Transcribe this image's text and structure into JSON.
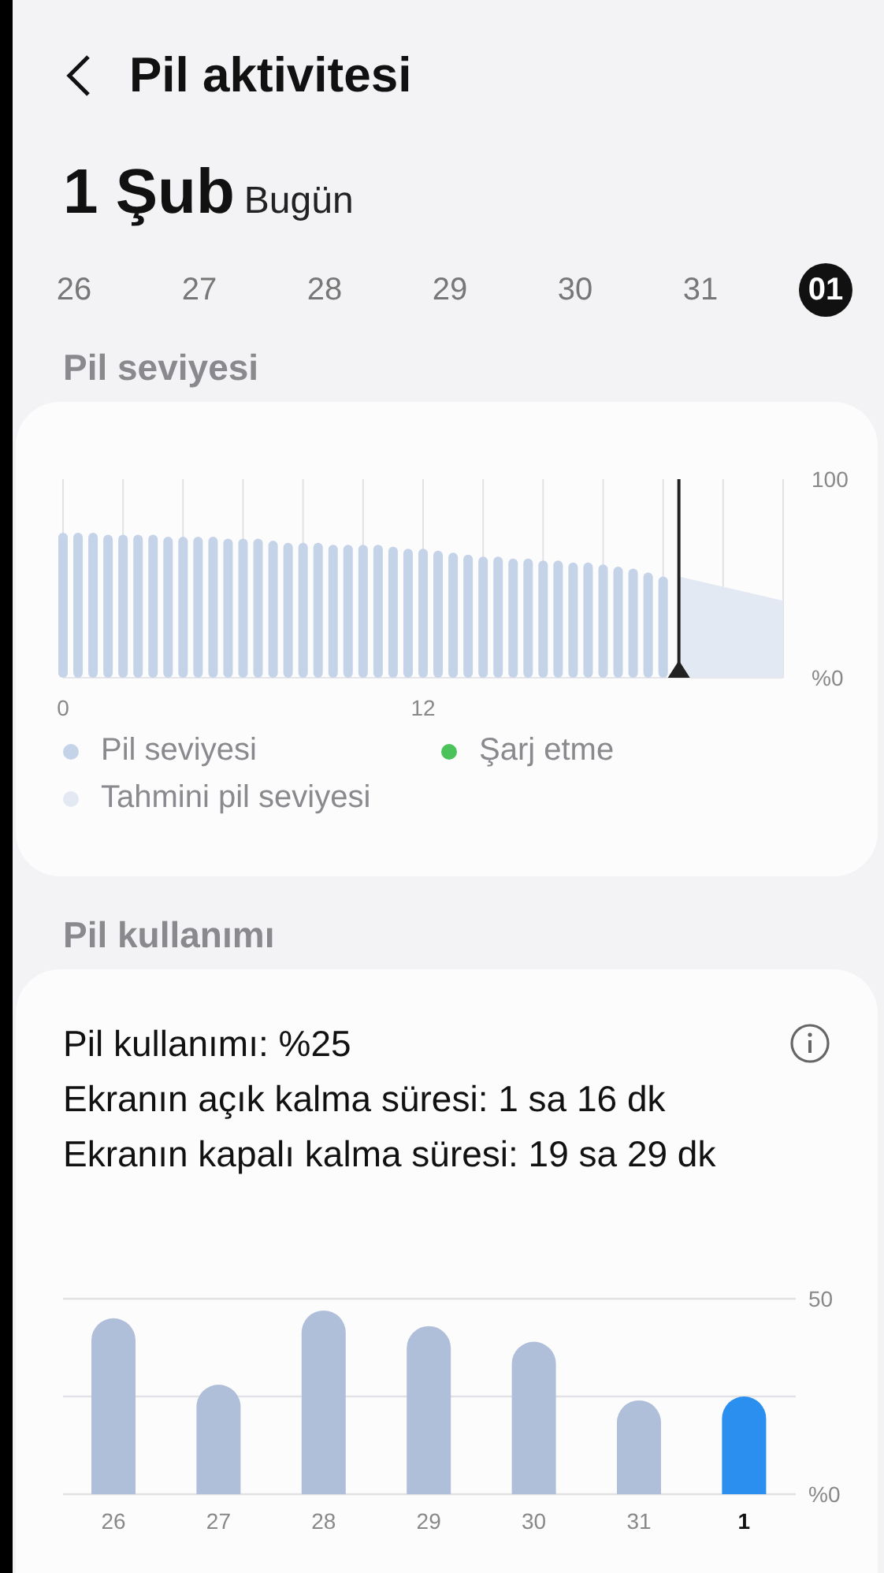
{
  "header": {
    "title": "Pil aktivitesi"
  },
  "date": {
    "day": "1 Şub",
    "label": "Bugün"
  },
  "days": [
    {
      "label": "26",
      "selected": false
    },
    {
      "label": "27",
      "selected": false
    },
    {
      "label": "28",
      "selected": false
    },
    {
      "label": "29",
      "selected": false
    },
    {
      "label": "30",
      "selected": false
    },
    {
      "label": "31",
      "selected": false
    },
    {
      "label": "01",
      "selected": true
    }
  ],
  "battery_level": {
    "heading": "Pil seviyesi",
    "chart_data": {
      "type": "bar",
      "x": [
        0,
        0.5,
        1,
        1.5,
        2,
        2.5,
        3,
        3.5,
        4,
        4.5,
        5,
        5.5,
        6,
        6.5,
        7,
        7.5,
        8,
        8.5,
        9,
        9.5,
        10,
        10.5,
        11,
        11.5,
        12,
        12.5,
        13,
        13.5,
        14,
        14.5,
        15,
        15.5,
        16,
        16.5,
        17,
        17.5,
        18,
        18.5,
        19,
        19.5,
        20
      ],
      "series": [
        {
          "name": "Pil seviyesi",
          "color": "#c5d3e8",
          "values": [
            73,
            73,
            73,
            72,
            72,
            72,
            72,
            71,
            71,
            71,
            71,
            70,
            70,
            70,
            69,
            68,
            68,
            68,
            67,
            67,
            67,
            67,
            66,
            65,
            65,
            64,
            63,
            62,
            61,
            61,
            60,
            60,
            59,
            59,
            58,
            58,
            57,
            56,
            55,
            53,
            51
          ]
        }
      ],
      "xlim": [
        0,
        24
      ],
      "ylim": [
        0,
        100
      ],
      "xticks": [
        0,
        12
      ],
      "yticks": [
        {
          "value": 0,
          "label": "%0"
        },
        {
          "value": 100,
          "label": "100"
        }
      ]
    },
    "legend": [
      {
        "label": "Şarj etme",
        "color": "#4cc35a"
      },
      {
        "label": "Tahmini pil seviyesi",
        "color": "#e3e9f3"
      }
    ]
  },
  "battery_usage": {
    "heading": "Pil kullanımı",
    "lines": [
      "Pil kullanımı: %25",
      "Ekranın açık kalma süresi: 1 sa 16 dk",
      "Ekranın kapalı kalma süresi: 19 sa 29 dk"
    ],
    "chart_data": {
      "type": "bar",
      "categories": [
        "26",
        "27",
        "28",
        "29",
        "30",
        "31",
        "1"
      ],
      "series": [
        {
          "colors": [
            "#b0bfd9",
            "#b0bfd9",
            "#b0bfd9",
            "#b0bfd9",
            "#b0bfd9",
            "#b0bfd9",
            "#2a8fef"
          ],
          "values": [
            45,
            28,
            47,
            43,
            39,
            24,
            25
          ]
        }
      ],
      "ylim": [
        0,
        50
      ],
      "yticks": [
        {
          "value": 0,
          "label": "%0"
        },
        50
      ]
    }
  }
}
